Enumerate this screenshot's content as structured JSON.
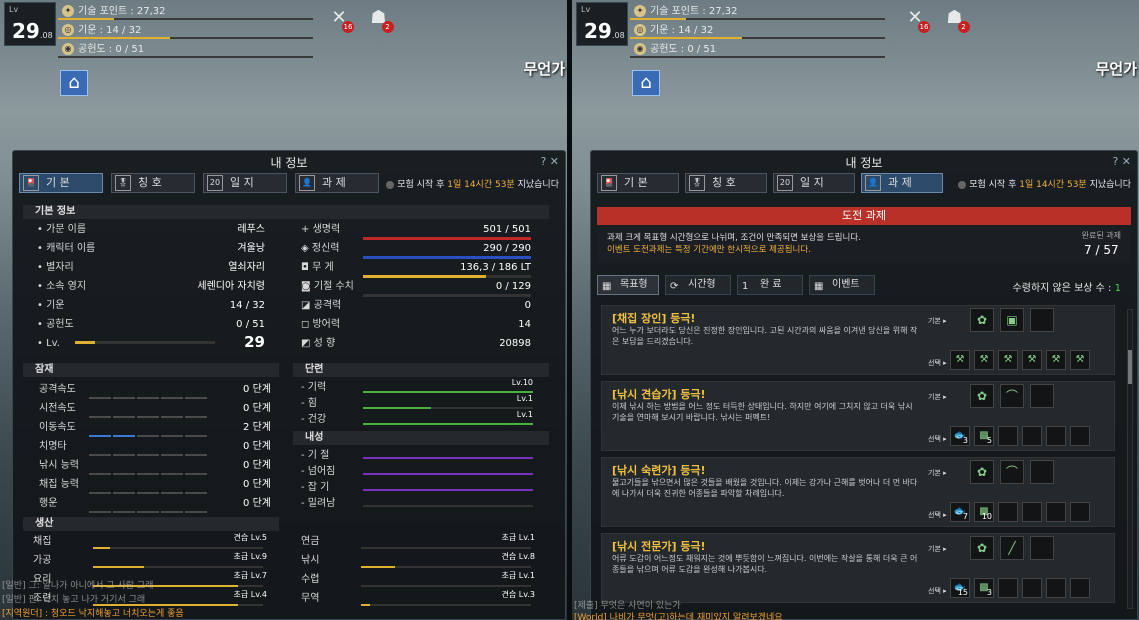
{
  "hud": {
    "lv_label": "Lv",
    "level": "29",
    "level_decimal": ".08",
    "skill_points": "기술 포인트 : 27,32",
    "energy": "기운 : 14 / 32",
    "contribution": "공헌도 : 0 / 51",
    "badge_skill": "16",
    "badge_alert": "2",
    "region": "무언가"
  },
  "panel": {
    "title": "내 정보",
    "help": "?",
    "close": "✕",
    "tabs": [
      "기 본",
      "칭 호",
      "일 지",
      "과 제"
    ],
    "tab_icons": [
      "🎴",
      "🎖",
      "20",
      "👤"
    ],
    "adventure_prefix": "모험 시작 후",
    "adventure_time": "1일 14시간 53분",
    "adventure_suffix": "지났습니다"
  },
  "left": {
    "basic_header": "기본 정보",
    "basic_rows": [
      {
        "label": "• 가문 이름",
        "value": "레푸스"
      },
      {
        "label": "• 캐릭터 이름",
        "value": "겨울낭"
      },
      {
        "label": "• 별자리",
        "value": "열쇠자리"
      },
      {
        "label": "• 소속 영지",
        "value": "세렌디아 자치령"
      },
      {
        "label": "• 기운",
        "value": "14 / 32"
      },
      {
        "label": "• 공헌도",
        "value": "0 / 51"
      },
      {
        "label": "• Lv.",
        "value": "29"
      }
    ],
    "stat_rows": [
      {
        "label": "생명력",
        "value": "501 / 501",
        "fill": 1.0,
        "color": "#c02828"
      },
      {
        "label": "정신력",
        "value": "290 / 290",
        "fill": 1.0,
        "color": "#2850c0"
      },
      {
        "label": "무 게",
        "value": "136,3 / 186 LT",
        "fill": 0.73,
        "color": "#e0b030"
      },
      {
        "label": "기절 수치",
        "value": "0 / 129",
        "fill": 0.0,
        "color": "#888888"
      },
      {
        "label": "공격력",
        "value": "0"
      },
      {
        "label": "방어력",
        "value": "14"
      },
      {
        "label": "성 향",
        "value": "20898"
      }
    ],
    "potential_header": "잠재",
    "potential_rows": [
      {
        "label": "공격속도",
        "value": "0 단계",
        "level": 0
      },
      {
        "label": "시전속도",
        "value": "0 단계",
        "level": 0
      },
      {
        "label": "이동속도",
        "value": "2 단계",
        "level": 2
      },
      {
        "label": "치명타",
        "value": "0 단계",
        "level": 0
      },
      {
        "label": "낚시 능력",
        "value": "0 단계",
        "level": 0
      },
      {
        "label": "채집 능력",
        "value": "0 단계",
        "level": 0
      },
      {
        "label": "행운",
        "value": "0 단계",
        "level": 0
      }
    ],
    "training_header": "단련",
    "training_rows": [
      {
        "label": "- 기력",
        "value": "Lv.10",
        "fill": 1.0
      },
      {
        "label": "- 힘",
        "value": "Lv.1",
        "fill": 0.4
      },
      {
        "label": "- 건강",
        "value": "Lv.1",
        "fill": 1.0
      }
    ],
    "resist_header": "내성",
    "resist_rows": [
      {
        "label": "- 기 절",
        "fill": 1.0
      },
      {
        "label": "- 넘어짐",
        "fill": 1.0
      },
      {
        "label": "- 잡 기",
        "fill": 1.0
      },
      {
        "label": "- 밀려남",
        "fill": 0.0
      }
    ],
    "life_header": "생산",
    "life_left": [
      {
        "label": "채집",
        "value": "견습 Lv.5",
        "fill": 0.1
      },
      {
        "label": "가공",
        "value": "초급 Lv.9",
        "fill": 0.3
      },
      {
        "label": "요리",
        "value": "초급 Lv.7",
        "fill": 0.85
      },
      {
        "label": "조련",
        "value": "초급 Lv.4",
        "fill": 0.85
      }
    ],
    "life_right": [
      {
        "label": "연금",
        "value": "초급 Lv.1",
        "fill": 0.0
      },
      {
        "label": "낚시",
        "value": "견습 Lv.8",
        "fill": 0.2
      },
      {
        "label": "수렵",
        "value": "초급 Lv.1",
        "fill": 0.0
      },
      {
        "label": "무역",
        "value": "견습 Lv.3",
        "fill": 0.05
      }
    ],
    "chat": [
      "[일반] 그: 알나가 아니에서 그 사람 그래",
      "[일반] 판: 닥치 놓고 나가 거기서 그래",
      "[지역원더] : 청오드 낙지해놓고 너치오는게 좋음"
    ]
  },
  "right": {
    "banner": "도전 과제",
    "info_line1": "과제 크게 목표형 시간형으로 나뉘며, 조건이 만족되면 보상을 드립니다.",
    "info_line2": "이벤트 도전과제는 특정 기간에만 한시적으로 제공됩니다.",
    "completed_label": "완료된 과제",
    "completed_value": "7 / 57",
    "tabs": [
      "목표형",
      "시간형",
      "완 료",
      "이벤트"
    ],
    "tab_icons": [
      "▦",
      "⟳",
      "1",
      "▦"
    ],
    "unclaimed_label": "수령하지 않은 보상 수 :",
    "unclaimed_value": "1",
    "basic_label": "기본 ▸",
    "choice_label": "선택 ▸",
    "quests": [
      {
        "title": "[채집 장인] 등극!",
        "desc": "어느 누가 보더라도 당신은 진정한 장인입니다. 고된 시간과의 싸움을 이겨낸 당신을 위해 작은 보답을 드리겠습니다.",
        "basic": [
          "✿",
          "▣",
          ""
        ],
        "choice": [
          {
            "i": "⚒",
            "q": ""
          },
          {
            "i": "⚒",
            "q": ""
          },
          {
            "i": "⚒",
            "q": ""
          },
          {
            "i": "⚒",
            "q": ""
          },
          {
            "i": "⚒",
            "q": ""
          },
          {
            "i": "⚒",
            "q": ""
          }
        ]
      },
      {
        "title": "[낚시 견습가] 등극!",
        "desc": "이제 낚시 하는 방법을 어느 정도 터득한 상태입니다. 하지만 여기에 그치지 않고 더욱 낚시 기술을 연마해 보시기 바랍니다. 낚시는 퍼펙트!",
        "basic": [
          "✿",
          "⌒",
          ""
        ],
        "choice": [
          {
            "i": "🐟",
            "q": "3"
          },
          {
            "i": "▩",
            "q": "5"
          },
          {
            "i": "",
            "q": ""
          },
          {
            "i": "",
            "q": ""
          },
          {
            "i": "",
            "q": ""
          },
          {
            "i": "",
            "q": ""
          }
        ]
      },
      {
        "title": "[낚시 숙련가] 등극!",
        "desc": "물고기들을 낚으면서 많은 것들을 배웠을 것입니다. 이제는 강가나 근해를 벗어나 더 먼 바다에 나가서 더욱 진귀한 어종들을 파악할 차례입니다.",
        "basic": [
          "✿",
          "⌒",
          ""
        ],
        "choice": [
          {
            "i": "🐟",
            "q": "7"
          },
          {
            "i": "▩",
            "q": "10"
          },
          {
            "i": "",
            "q": ""
          },
          {
            "i": "",
            "q": ""
          },
          {
            "i": "",
            "q": ""
          },
          {
            "i": "",
            "q": ""
          }
        ]
      },
      {
        "title": "[낚시 전문가] 등극!",
        "desc": "어류 도감이 어느정도 채워지는 것에 뿌듯함이 느껴집니다. 이번에는 작살을 통해 더욱 큰 어종들을 낚으며 어류 도감을 완성해 나가봅시다.",
        "basic": [
          "✿",
          "╱",
          ""
        ],
        "choice": [
          {
            "i": "🐟",
            "q": "15"
          },
          {
            "i": "▩",
            "q": "3"
          },
          {
            "i": "",
            "q": ""
          },
          {
            "i": "",
            "q": ""
          },
          {
            "i": "",
            "q": ""
          },
          {
            "i": "",
            "q": ""
          }
        ]
      }
    ],
    "chat": [
      "[제출] 무엇은 사연이 있는가",
      "[World] 나비가 무엇(고)하는데 재미있지 알려보겠네요"
    ]
  }
}
